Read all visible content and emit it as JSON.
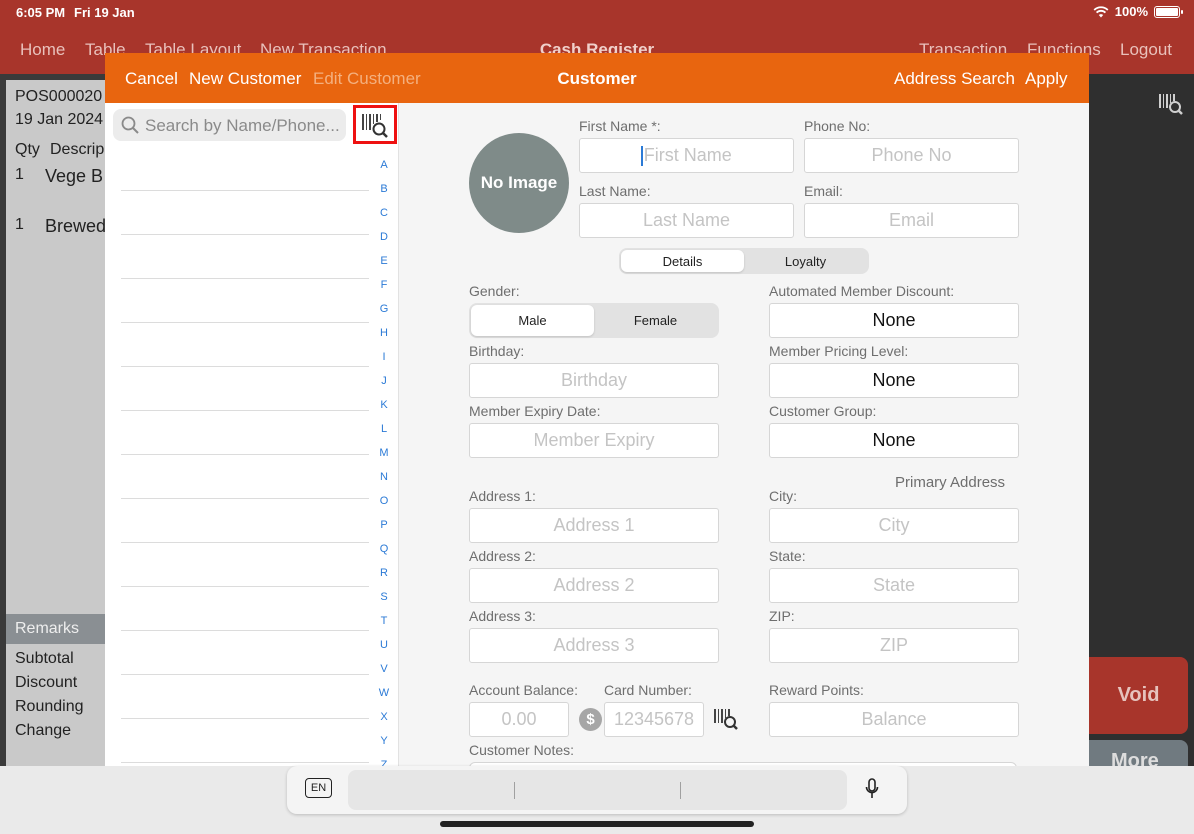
{
  "status_bar": {
    "time": "6:05 PM",
    "date": "Fri 19 Jan",
    "battery": "100%"
  },
  "app_nav": {
    "title": "Cash Register",
    "left_items": [
      "Home",
      "Table",
      "Table Layout",
      "New Transaction"
    ],
    "right_items": [
      "Transaction",
      "Functions",
      "Logout"
    ]
  },
  "background": {
    "receipt_no": "POS000020",
    "receipt_date": "19 Jan 2024",
    "col_qty": "Qty",
    "col_desc": "Descrip",
    "lines": [
      {
        "qty": "1",
        "desc": "Vege B"
      },
      {
        "qty": "1",
        "desc": "Brewed"
      }
    ],
    "remarks": "Remarks",
    "totals": [
      "Subtotal",
      "Discount",
      "Rounding",
      "Change"
    ],
    "void_label": "Void",
    "more_label": "More"
  },
  "modal": {
    "header": {
      "cancel": "Cancel",
      "new_customer": "New Customer",
      "edit_customer": "Edit Customer",
      "title": "Customer",
      "address_search": "Address Search",
      "apply": "Apply"
    },
    "search_placeholder": "Search by Name/Phone...",
    "alphabet": [
      "A",
      "B",
      "C",
      "D",
      "E",
      "F",
      "G",
      "H",
      "I",
      "J",
      "K",
      "L",
      "M",
      "N",
      "O",
      "P",
      "Q",
      "R",
      "S",
      "T",
      "U",
      "V",
      "W",
      "X",
      "Y",
      "Z"
    ],
    "form": {
      "avatar_text": "No Image",
      "first_name_label": "First Name *:",
      "first_name_placeholder": "First Name",
      "phone_label": "Phone No:",
      "phone_placeholder": "Phone No",
      "last_name_label": "Last Name:",
      "last_name_placeholder": "Last Name",
      "email_label": "Email:",
      "email_placeholder": "Email",
      "tabs": [
        "Details",
        "Loyalty"
      ],
      "gender_label": "Gender:",
      "gender_options": [
        "Male",
        "Female"
      ],
      "auto_discount_label": "Automated Member Discount:",
      "auto_discount_value": "None",
      "birthday_label": "Birthday:",
      "birthday_placeholder": "Birthday",
      "pricing_level_label": "Member Pricing Level:",
      "pricing_level_value": "None",
      "expiry_label": "Member Expiry Date:",
      "expiry_placeholder": "Member Expiry",
      "group_label": "Customer Group:",
      "group_value": "None",
      "primary_address": "Primary Address",
      "address1_label": "Address 1:",
      "address1_placeholder": "Address 1",
      "city_label": "City:",
      "city_placeholder": "City",
      "address2_label": "Address 2:",
      "address2_placeholder": "Address 2",
      "state_label": "State:",
      "state_placeholder": "State",
      "address3_label": "Address 3:",
      "address3_placeholder": "Address 3",
      "zip_label": "ZIP:",
      "zip_placeholder": "ZIP",
      "balance_label": "Account Balance:",
      "balance_placeholder": "0.00",
      "card_label": "Card Number:",
      "card_placeholder": "12345678",
      "reward_label": "Reward Points:",
      "reward_placeholder": "Balance",
      "notes_label": "Customer Notes:"
    }
  },
  "keyboard": {
    "language": "EN"
  },
  "colors": {
    "brand_red": "#a8352b",
    "modal_orange": "#e8650f",
    "highlight_border": "#e11111",
    "link_blue": "#2b7ad6"
  }
}
